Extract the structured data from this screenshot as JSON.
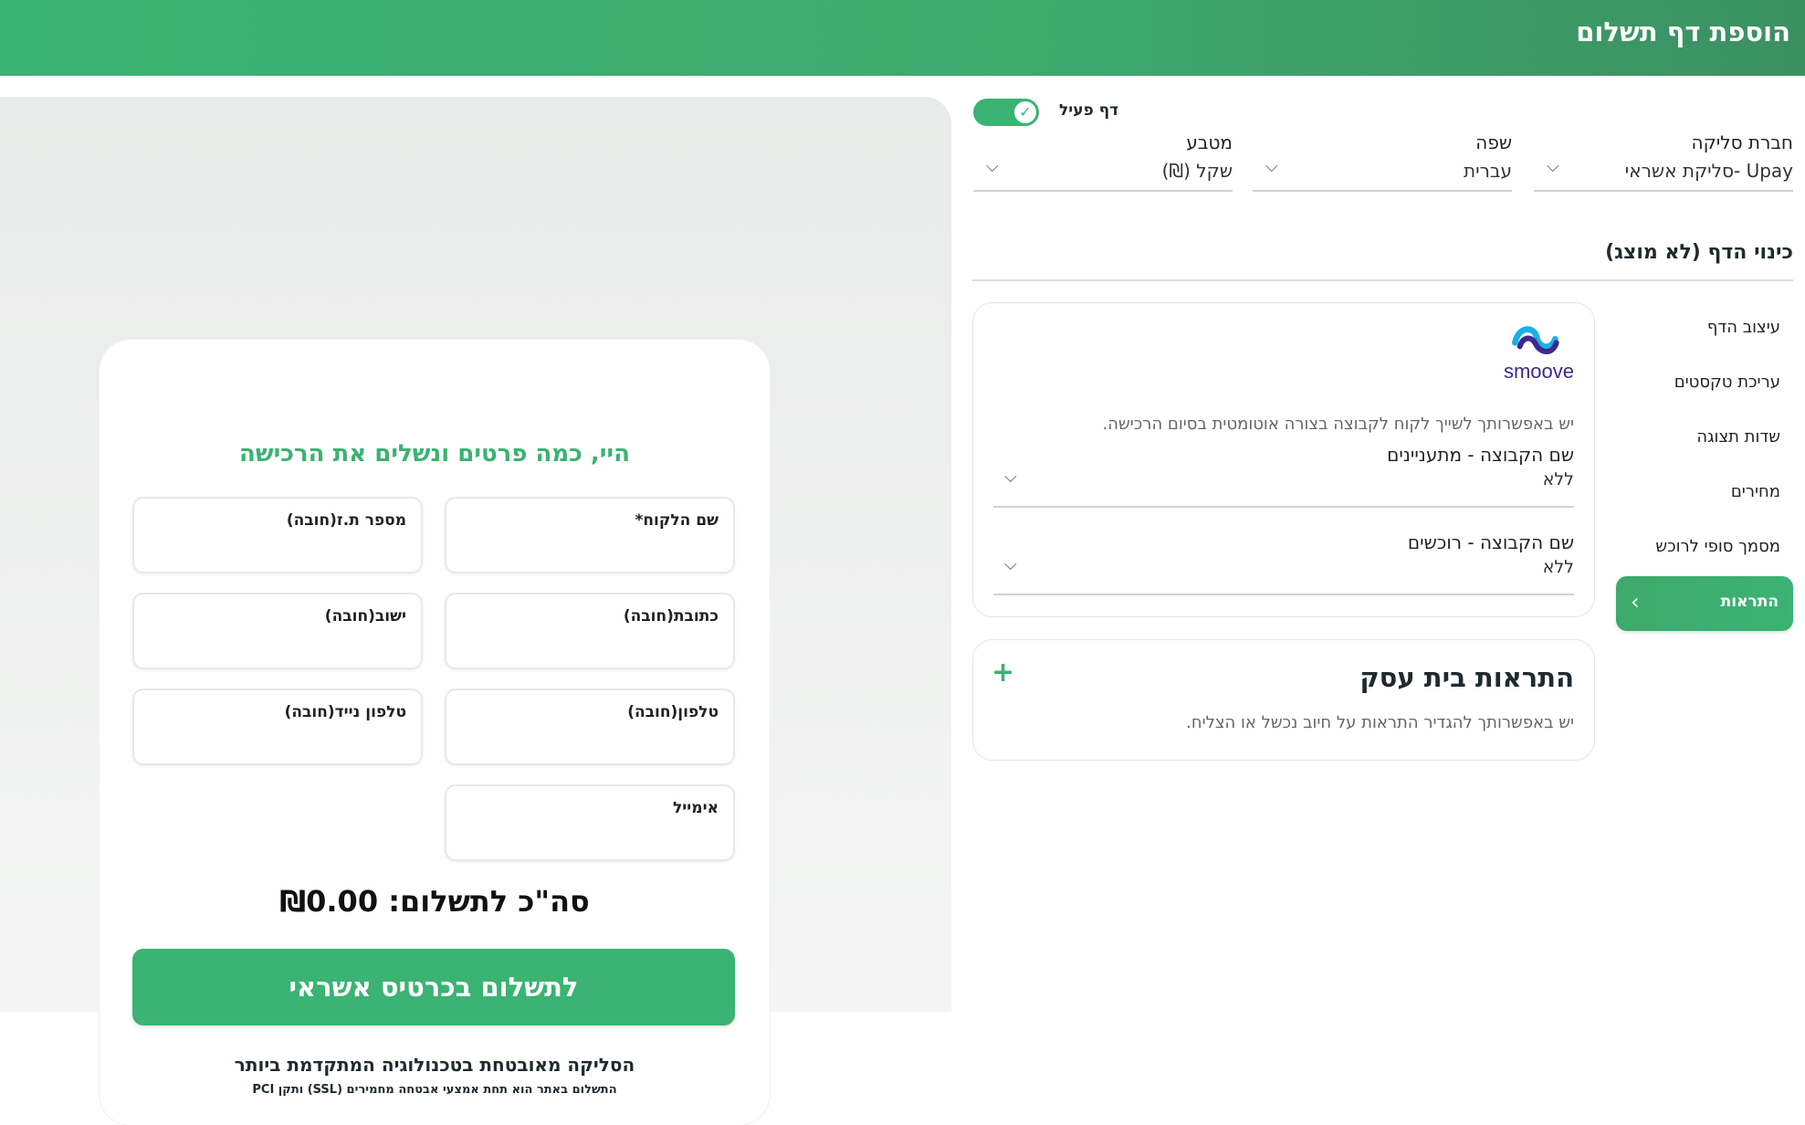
{
  "header": {
    "title": "הוספת דף תשלום"
  },
  "settings": {
    "active_label": "דף פעיל",
    "active": true,
    "clearing": {
      "label": "חברת סליקה",
      "value": "Upay -סליקת אשראי"
    },
    "language": {
      "label": "שפה",
      "value": "עברית"
    },
    "currency": {
      "label": "מטבע",
      "value": "שקל (₪)"
    },
    "page_name_label": "כינוי הדף (לא מוצג)"
  },
  "menu": {
    "items": [
      {
        "label": "עיצוב הדף"
      },
      {
        "label": "עריכת טקסטים"
      },
      {
        "label": "שדות תצוגה"
      },
      {
        "label": "מחירים"
      },
      {
        "label": "מסמך סופי לרוכש"
      }
    ],
    "active": {
      "label": "התראות"
    }
  },
  "smoove_panel": {
    "logo_text": "smoove",
    "description": "יש באפשרותך לשייך לקוח לקבוצה בצורה אוטומטית בסיום הרכישה.",
    "groups": [
      {
        "label": "שם הקבוצה - מתעניינים",
        "value": "ללא"
      },
      {
        "label": "שם הקבוצה - רוכשים",
        "value": "ללא"
      }
    ]
  },
  "alerts_panel": {
    "title": "התראות בית עסק",
    "description": "יש באפשרותך להגדיר התראות על חיוב נכשל או הצליח.",
    "add_icon": "plus-icon"
  },
  "preview": {
    "heading": "היי, כמה פרטים ונשלים את הרכישה",
    "fields": {
      "customer_name": "שם הלקוח*",
      "id_number": "מספר ת.ז(חובה)",
      "address": "כתובת(חובה)",
      "city": "ישוב(חובה)",
      "phone": "טלפון(חובה)",
      "mobile": "טלפון נייד(חובה)",
      "email": "אימייל"
    },
    "total": "סה\"כ לתשלום: ₪0.00",
    "pay_button": "לתשלום בכרטיס אשראי",
    "secure_line1": "הסליקה מאובטחת בטכנולוגיה המתקדמת ביותר",
    "secure_line2": "התשלום באתר הוא תחת אמצעי אבטחה מחמירים (SSL) ותקן PCI"
  },
  "colors": {
    "brand_green": "#3bb372",
    "smoove_purple": "#3d2a8a",
    "smoove_cyan": "#1ab0e6"
  }
}
